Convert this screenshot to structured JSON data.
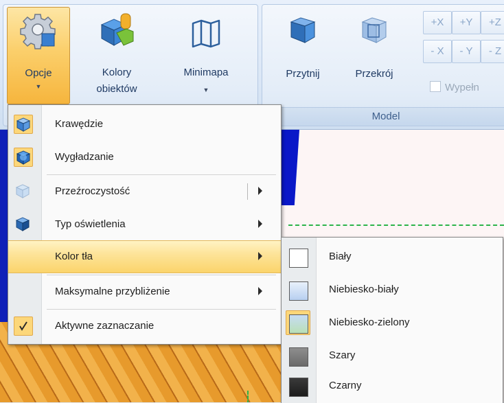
{
  "ribbon": {
    "buttons": {
      "opcje": "Opcje",
      "kolory_line1": "Kolory",
      "kolory_line2": "obiektów",
      "minimapa": "Minimapa",
      "przytnij": "Przytnij",
      "przekroj": "Przekrój"
    },
    "axis_buttons_row1": [
      "+X",
      "+Y",
      "+Z"
    ],
    "axis_buttons_row2": [
      "- X",
      "- Y",
      "- Z"
    ],
    "checkbox_label": "Wypełn",
    "group_label": "Model"
  },
  "menu": {
    "items": [
      {
        "label": "Krawędzie",
        "icon": "edges-cube-icon",
        "checked": true
      },
      {
        "label": "Wygładzanie",
        "icon": "smoothing-cube-icon",
        "checked": true
      },
      {
        "label": "Przeźroczystość",
        "icon": "transparency-cube-icon",
        "submenu": true
      },
      {
        "label": "Typ oświetlenia",
        "icon": "lighting-cube-icon",
        "submenu": true
      },
      {
        "label": "Kolor tła",
        "submenu": true,
        "highlighted": true
      },
      {
        "label": "Maksymalne przybliżenie",
        "submenu": true
      },
      {
        "label": "Aktywne zaznaczanie",
        "icon": "check-icon",
        "checked": true
      }
    ]
  },
  "submenu": {
    "items": [
      {
        "label": "Biały",
        "swatch": "#ffffff"
      },
      {
        "label": "Niebiesko-biały",
        "swatch": "#c9dcf3"
      },
      {
        "label": "Niebiesko-zielony",
        "swatch": "#bfe0c0",
        "selected": true
      },
      {
        "label": "Szary",
        "swatch": "#7d7d7d"
      },
      {
        "label": "Czarny",
        "swatch": "#2a2a2a"
      }
    ]
  },
  "colors": {
    "highlight": "#fbd46b",
    "ribbon_text": "#1f3a63",
    "scene_blue": "#0a18c8",
    "scene_orange": "#e79a2c"
  }
}
